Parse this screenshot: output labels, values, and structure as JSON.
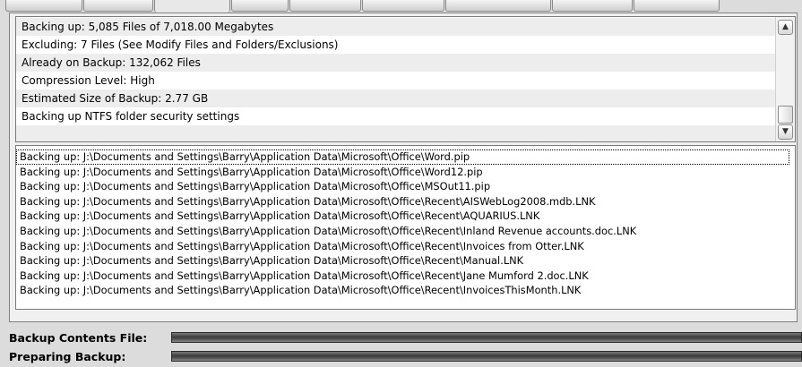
{
  "summary": {
    "rows": [
      "Backing up: 5,085 Files of 7,018.00 Megabytes",
      "Excluding: 7 Files (See Modify Files and Folders/Exclusions)",
      "Already on Backup: 132,062 Files",
      "Compression Level: High",
      "Estimated Size of Backup: 2.77 GB",
      "Backing up NTFS folder security settings",
      ""
    ],
    "scroll_up_glyph": "▲",
    "scroll_down_glyph": "▼"
  },
  "log": {
    "rows": [
      "Backing up: J:\\Documents and Settings\\Barry\\Application Data\\Microsoft\\Office\\Word.pip",
      "Backing up: J:\\Documents and Settings\\Barry\\Application Data\\Microsoft\\Office\\Word12.pip",
      "Backing up: J:\\Documents and Settings\\Barry\\Application Data\\Microsoft\\Office\\MSOut11.pip",
      "Backing up: J:\\Documents and Settings\\Barry\\Application Data\\Microsoft\\Office\\Recent\\AISWebLog2008.mdb.LNK",
      "Backing up: J:\\Documents and Settings\\Barry\\Application Data\\Microsoft\\Office\\Recent\\AQUARIUS.LNK",
      "Backing up: J:\\Documents and Settings\\Barry\\Application Data\\Microsoft\\Office\\Recent\\Inland Revenue accounts.doc.LNK",
      "Backing up: J:\\Documents and Settings\\Barry\\Application Data\\Microsoft\\Office\\Recent\\Invoices from Otter.LNK",
      "Backing up: J:\\Documents and Settings\\Barry\\Application Data\\Microsoft\\Office\\Recent\\Manual.LNK",
      "Backing up: J:\\Documents and Settings\\Barry\\Application Data\\Microsoft\\Office\\Recent\\Jane Mumford 2.doc.LNK",
      "Backing up: J:\\Documents and Settings\\Barry\\Application Data\\Microsoft\\Office\\Recent\\InvoicesThisMonth.LNK"
    ]
  },
  "progress": {
    "backup_contents_label": "Backup Contents File:",
    "backup_contents_fraction": 1.0,
    "preparing_label": "Preparing Backup:",
    "preparing_fraction": 1.0
  },
  "colors": {
    "window_bg": "#dcdcdc",
    "list_bg": "#ffffff",
    "alt_row": "#ededed",
    "progress_fill": "#3c3c3c"
  }
}
